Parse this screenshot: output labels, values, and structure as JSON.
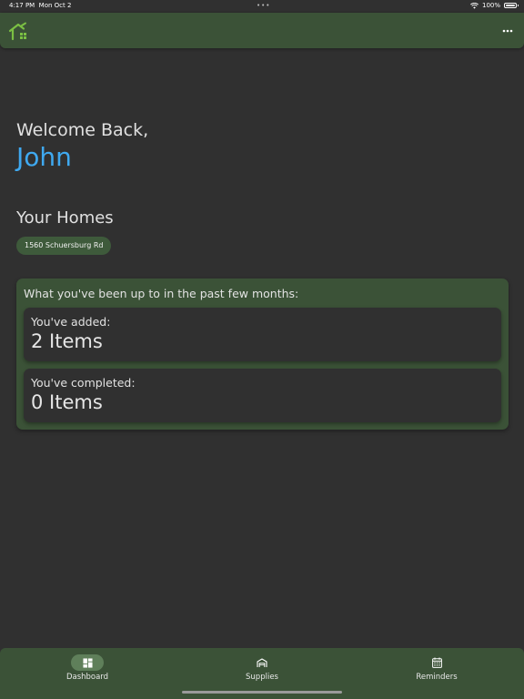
{
  "status_bar": {
    "time": "4:17 PM",
    "date": "Mon Oct 2",
    "dots": "•••",
    "battery": "100%"
  },
  "app_bar": {
    "logo_icon": "house-check-icon",
    "more_icon": "more-horizontal-icon",
    "brand_color": "#3b5237",
    "logo_color": "#7bc043"
  },
  "greeting": {
    "welcome": "Welcome Back,",
    "name": "John",
    "name_color": "#3fa9f0"
  },
  "homes": {
    "title": "Your Homes",
    "items": [
      {
        "label": "1560 Schuersburg Rd"
      }
    ]
  },
  "summary": {
    "heading": "What you've been up to in the past few months:",
    "added": {
      "label": "You've added:",
      "value": "2 Items"
    },
    "completed": {
      "label": "You've completed:",
      "value": "0 Items"
    }
  },
  "bottom_nav": {
    "items": [
      {
        "label": "Dashboard",
        "icon": "dashboard-grid-icon",
        "active": true
      },
      {
        "label": "Supplies",
        "icon": "garage-icon",
        "active": false
      },
      {
        "label": "Reminders",
        "icon": "calendar-icon",
        "active": false
      }
    ]
  }
}
